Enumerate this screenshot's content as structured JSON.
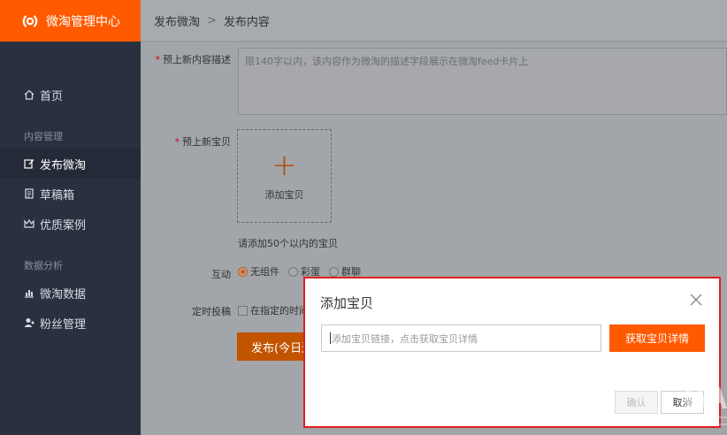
{
  "brand": {
    "title": "微淘管理中心",
    "color": "#ff5a00"
  },
  "breadcrumb": {
    "root": "发布微淘",
    "separator": ">",
    "current": "发布内容"
  },
  "sidebar": {
    "home": {
      "label": "首页",
      "icon": "home-icon"
    },
    "section_content": "内容管理",
    "items_content": [
      {
        "label": "发布微淘",
        "icon": "edit-icon",
        "active": true
      },
      {
        "label": "草稿箱",
        "icon": "draft-icon"
      },
      {
        "label": "优质案例",
        "icon": "crown-icon"
      }
    ],
    "section_data": "数据分析",
    "items_data": [
      {
        "label": "微淘数据",
        "icon": "bar-chart-icon"
      },
      {
        "label": "粉丝管理",
        "icon": "user-icon"
      }
    ]
  },
  "form": {
    "description": {
      "required_mark": "*",
      "label": "预上新内容描述",
      "placeholder": "限140字以内，该内容作为微淘的描述字段展示在微淘feed卡片上"
    },
    "items": {
      "required_mark": "*",
      "label": "预上新宝贝",
      "add_label": "添加宝贝",
      "hint": "请添加50个以内的宝贝"
    },
    "interaction": {
      "label": "互动",
      "options": [
        "无组件",
        "彩蛋",
        "群聊"
      ],
      "selected": "无组件"
    },
    "schedule": {
      "label": "定时投稿",
      "checkbox_label": "在指定的时间"
    },
    "publish_button": "发布(今日还"
  },
  "dialog": {
    "title": "添加宝贝",
    "input_placeholder": "添加宝贝链接，点击获取宝贝详情",
    "fetch_button": "获取宝贝详情",
    "confirm_button": "确认",
    "cancel_button": "取消"
  }
}
